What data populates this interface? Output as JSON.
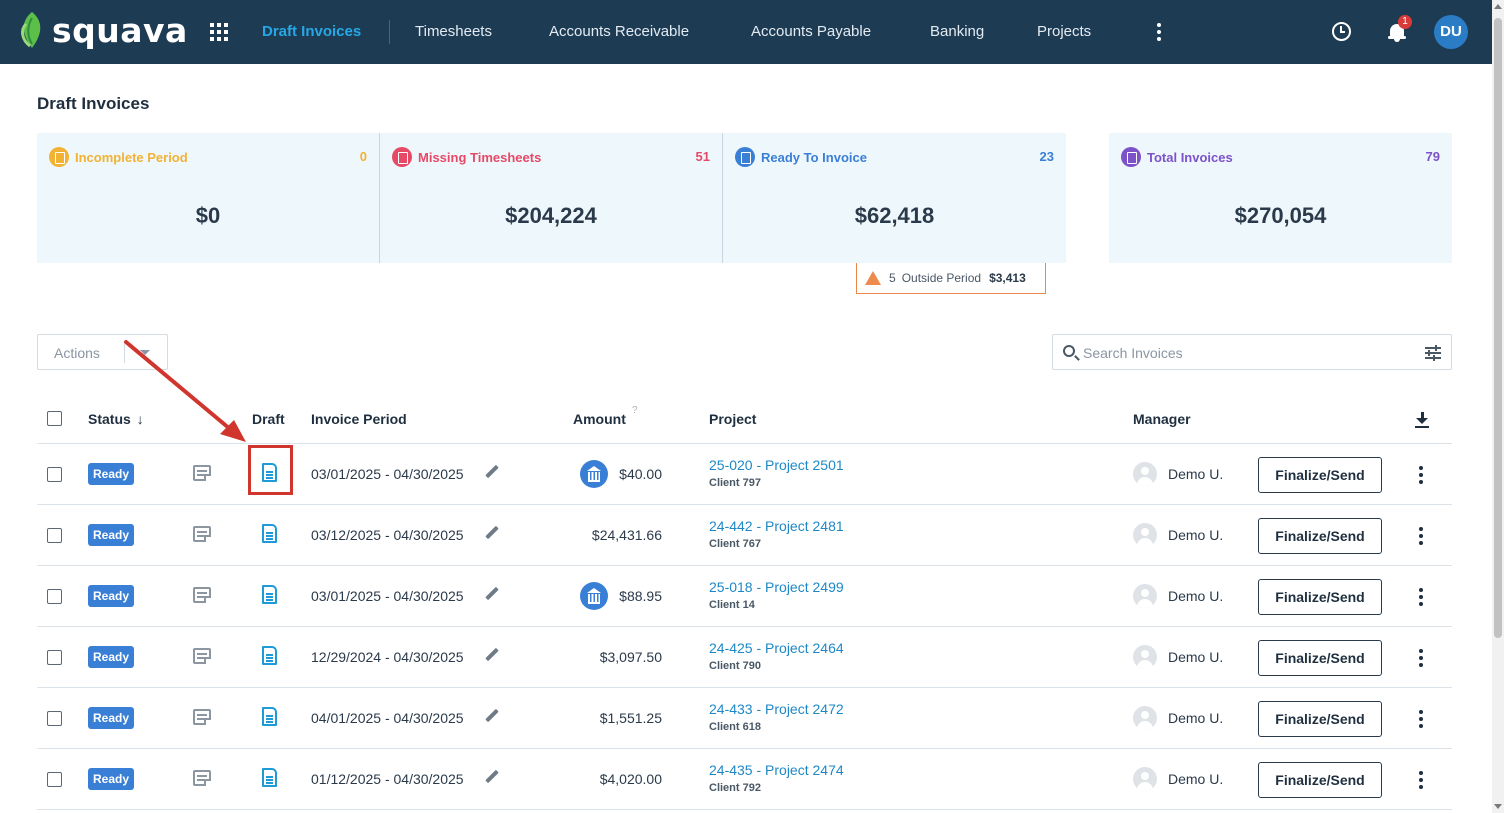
{
  "app": {
    "brand": "squava",
    "nav": [
      {
        "label": "Draft Invoices",
        "active": true
      },
      {
        "label": "Timesheets",
        "active": false
      },
      {
        "label": "Accounts Receivable",
        "active": false
      },
      {
        "label": "Accounts Payable",
        "active": false
      },
      {
        "label": "Banking",
        "active": false
      },
      {
        "label": "Projects",
        "active": false
      }
    ],
    "notifications_count": "1",
    "user_initials": "DU"
  },
  "page": {
    "title": "Draft Invoices"
  },
  "cards": [
    {
      "label": "Incomplete Period",
      "count": "0",
      "amount": "$0",
      "color": "#f2b233"
    },
    {
      "label": "Missing Timesheets",
      "count": "51",
      "amount": "$204,224",
      "color": "#e64a66"
    },
    {
      "label": "Ready To Invoice",
      "count": "23",
      "amount": "$62,418",
      "color": "#3a7fd6"
    },
    {
      "label": "Total Invoices",
      "count": "79",
      "amount": "$270,054",
      "color": "#7d52c9"
    }
  ],
  "outside_period": {
    "count": "5",
    "label": "Outside Period",
    "amount": "$3,413"
  },
  "toolbar": {
    "actions_label": "Actions",
    "search_placeholder": "Search Invoices"
  },
  "table": {
    "headers": {
      "status": "Status",
      "draft": "Draft",
      "period": "Invoice Period",
      "amount": "Amount",
      "amount_hint": "?",
      "project": "Project",
      "manager": "Manager"
    },
    "rows": [
      {
        "status": "Ready",
        "period": "03/01/2025 - 04/30/2025",
        "bank": true,
        "amount": "$40.00",
        "project": "25-020 - Project 2501",
        "client": "Client 797",
        "manager": "Demo U.",
        "action": "Finalize/Send"
      },
      {
        "status": "Ready",
        "period": "03/12/2025 - 04/30/2025",
        "bank": false,
        "amount": "$24,431.66",
        "project": "24-442 - Project 2481",
        "client": "Client 767",
        "manager": "Demo U.",
        "action": "Finalize/Send"
      },
      {
        "status": "Ready",
        "period": "03/01/2025 - 04/30/2025",
        "bank": true,
        "amount": "$88.95",
        "project": "25-018 - Project 2499",
        "client": "Client 14",
        "manager": "Demo U.",
        "action": "Finalize/Send"
      },
      {
        "status": "Ready",
        "period": "12/29/2024 - 04/30/2025",
        "bank": false,
        "amount": "$3,097.50",
        "project": "24-425 - Project 2464",
        "client": "Client 790",
        "manager": "Demo U.",
        "action": "Finalize/Send"
      },
      {
        "status": "Ready",
        "period": "04/01/2025 - 04/30/2025",
        "bank": false,
        "amount": "$1,551.25",
        "project": "24-433 - Project 2472",
        "client": "Client 618",
        "manager": "Demo U.",
        "action": "Finalize/Send"
      },
      {
        "status": "Ready",
        "period": "01/12/2025 - 04/30/2025",
        "bank": false,
        "amount": "$4,020.00",
        "project": "24-435 - Project 2474",
        "client": "Client 792",
        "manager": "Demo U.",
        "action": "Finalize/Send"
      }
    ]
  }
}
